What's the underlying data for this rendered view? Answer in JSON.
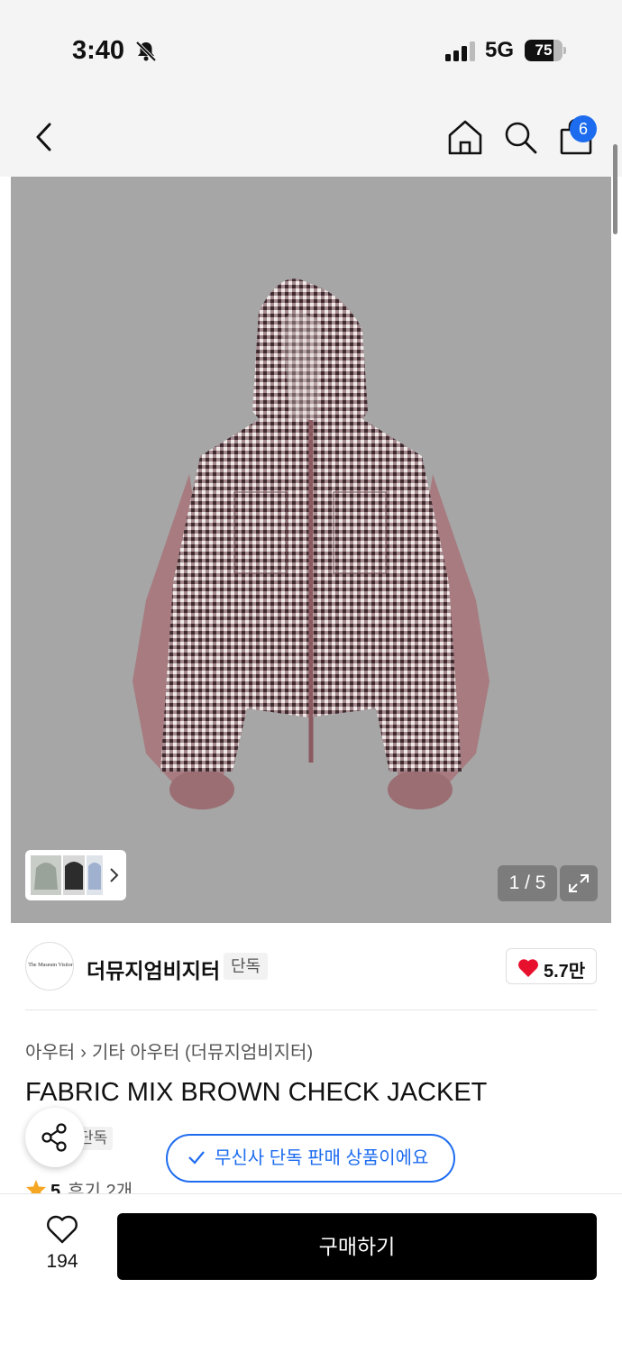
{
  "status_bar": {
    "time": "3:40",
    "network": "5G",
    "battery": "75",
    "battery_level": 0.75
  },
  "nav": {
    "cart_count": "6",
    "icons": [
      "chevron-left-icon",
      "home-icon",
      "search-icon",
      "shopping-bag-icon"
    ]
  },
  "gallery": {
    "counter": "1 / 5",
    "expand_icon": "expand-icon"
  },
  "brand": {
    "name": "더뮤지엄비지터",
    "tag": "단독",
    "likes": "5.7만",
    "logo_text": "The Museum Visitor"
  },
  "product": {
    "breadcrumb": [
      "아우터",
      "기타 아우터 (더뮤지엄비지터)"
    ],
    "title": "FABRIC MIX BROWN CHECK JACKET",
    "exclusive_tag": "단독",
    "notice": "무신사 단독 판매 상품이에요",
    "rating": "5",
    "reviews": "후기 2개"
  },
  "bottom": {
    "wish_count": "194",
    "buy_label": "구매하기"
  },
  "colors": {
    "accent": "#1d6cf0",
    "heart": "#e8112d",
    "star": "#f5a623",
    "buy_bg": "#000000"
  }
}
